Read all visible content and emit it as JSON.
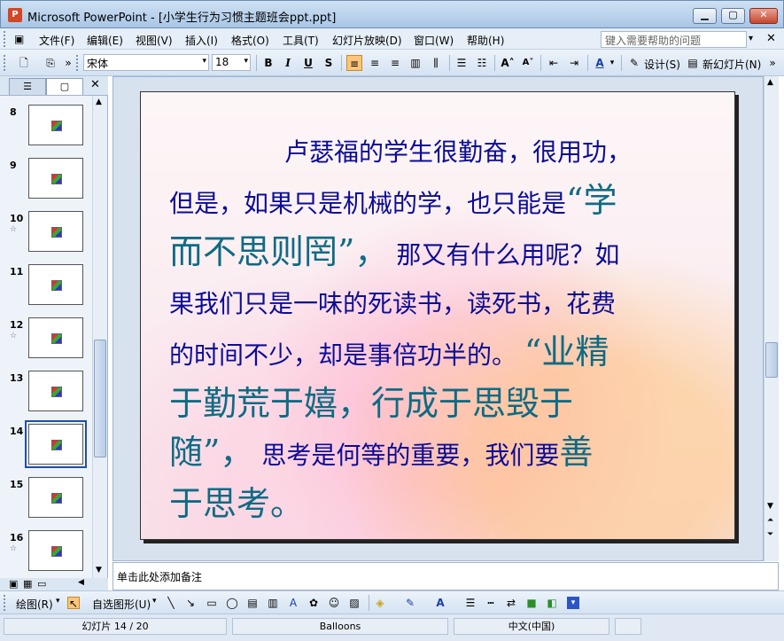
{
  "window": {
    "title": "Microsoft PowerPoint - [小学生行为习惯主题班会ppt.ppt]",
    "app_icon_letter": "P",
    "minimize": "▁",
    "maximize": "▢",
    "close": "✕"
  },
  "menu": {
    "items": [
      "文件(F)",
      "编辑(E)",
      "视图(V)",
      "插入(I)",
      "格式(O)",
      "工具(T)",
      "幻灯片放映(D)",
      "窗口(W)",
      "帮助(H)"
    ],
    "help_placeholder": "键入需要帮助的问题",
    "help_arrow": "▾",
    "close": "✕"
  },
  "toolbar": {
    "font_name": "宋体",
    "font_size": "18",
    "bold": "B",
    "italic": "I",
    "underline": "U",
    "shadow": "S",
    "design_label": "设计(S)",
    "new_slide_label": "新幻灯片(N)",
    "dropdown_arrow": "▾"
  },
  "left_panel": {
    "close": "✕",
    "thumbnails": [
      {
        "num": "8",
        "star": ""
      },
      {
        "num": "9",
        "star": ""
      },
      {
        "num": "10",
        "star": "☆"
      },
      {
        "num": "11",
        "star": ""
      },
      {
        "num": "12",
        "star": "☆"
      },
      {
        "num": "13",
        "star": ""
      },
      {
        "num": "14",
        "star": "",
        "selected": true
      },
      {
        "num": "15",
        "star": ""
      },
      {
        "num": "16",
        "star": "☆"
      }
    ]
  },
  "slide": {
    "line1": "卢瑟福的学生很勤奋，很用功，",
    "line2a": "但是，如果只是机械的学，也只能是",
    "quote1a": "“学",
    "quote1b": "而不思则罔”，",
    "line3": "那又有什么用呢？如",
    "line4": "果我们只是一味的死读书，读死书，花费",
    "line5": "的时间不少，却是事倍功半的。",
    "quote2a": "“业精",
    "quote2b": "于勤荒于嬉，行成于思毁于",
    "quote2c": "随”，",
    "line6": "思考是何等的重要，我们要",
    "big1": "善",
    "big2": "于思考。"
  },
  "notes": {
    "placeholder": "单击此处添加备注"
  },
  "draw_toolbar": {
    "draw_label": "绘图(R)",
    "autoshape_label": "自选图形(U)"
  },
  "status": {
    "slide_indicator": "幻灯片 14 / 20",
    "design_name": "Balloons",
    "language": "中文(中国)"
  }
}
